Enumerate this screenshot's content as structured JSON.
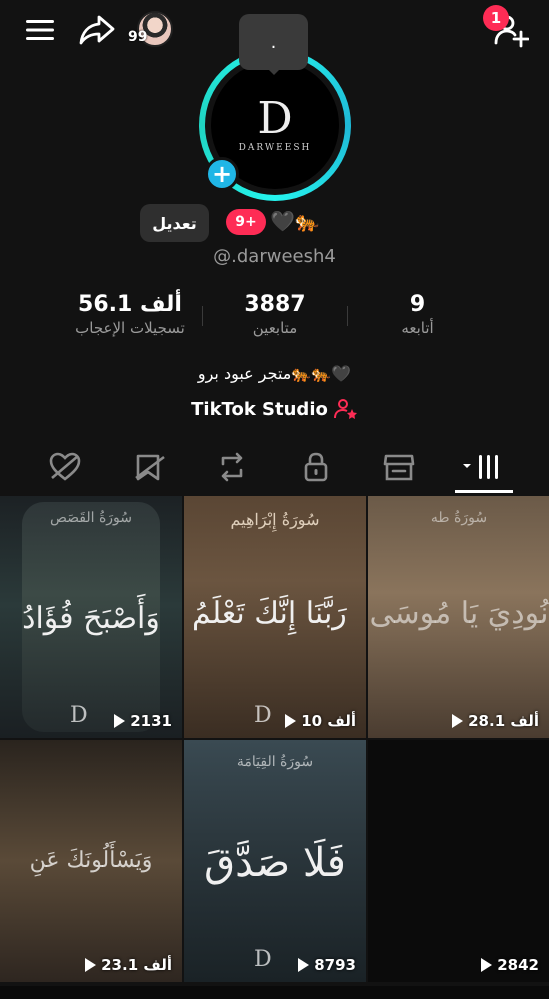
{
  "topbar": {
    "friend_count": "99",
    "notification_count": "1"
  },
  "profile": {
    "story_text": ".",
    "logo_letter": "D",
    "logo_name": "DARWEESH",
    "edit_label": "تعديل",
    "level_badge": "9+",
    "badge_emojis": "🖤🐅",
    "username": "@.darweesh4"
  },
  "stats": {
    "likes_value": "56.1 ألف",
    "likes_label": "تسجيلات الإعجاب",
    "followers_value": "3887",
    "followers_label": "متابعين",
    "following_value": "9",
    "following_label": "أتابعه"
  },
  "bio": "متجر عبود برو🐅🐅🖤",
  "studio_label": "TikTok Studio",
  "tabs": [
    "liked",
    "favorites",
    "reposts",
    "private",
    "shop",
    "videos"
  ],
  "videos": [
    {
      "title": "وَأَصْبَحَ فُؤَادُ",
      "surah": "سُورَةُ القَصَص",
      "views": "2131"
    },
    {
      "title": "رَبَّنَا إِنَّكَ تَعْلَمُ",
      "surah": "سُورَةُ إِبْرَاهِيم",
      "views": "10 ألف"
    },
    {
      "title": "نُودِيَ يَا مُوسَى",
      "surah": "سُورَةُ طه",
      "views": "28.1 ألف"
    },
    {
      "title": "وَيَسْأَلُونَكَ عَنِ",
      "surah": "",
      "views": "23.1 ألف"
    },
    {
      "title": "فَلَا صَدَّقَ",
      "surah": "سُورَةُ القِيَامَة",
      "views": "8793"
    },
    {
      "title": "",
      "surah": "",
      "views": "2842"
    }
  ],
  "colors": {
    "accent_pink": "#fe2c55",
    "accent_cyan": "#25f4ee",
    "background": "#121212"
  }
}
